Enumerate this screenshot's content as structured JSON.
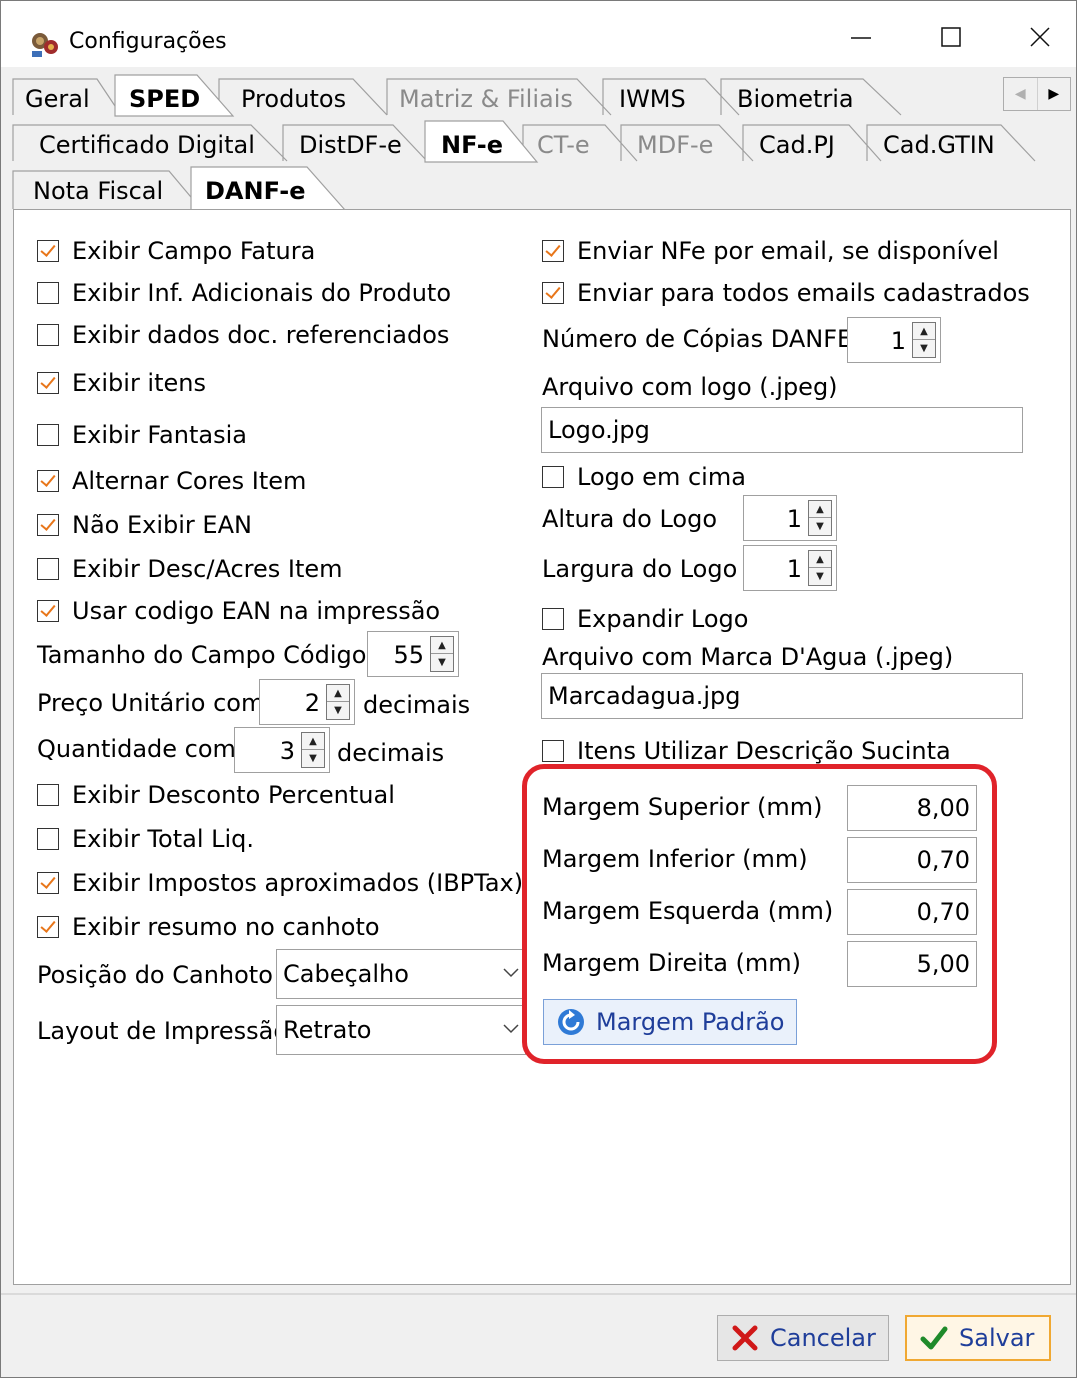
{
  "window": {
    "title": "Configurações",
    "minimize": "—",
    "maximize": "☐",
    "close": "✕"
  },
  "tabs_row1": [
    {
      "label": "Geral",
      "state": "normal"
    },
    {
      "label": "SPED",
      "state": "active"
    },
    {
      "label": "Produtos",
      "state": "normal"
    },
    {
      "label": "Matriz & Filiais",
      "state": "disabled"
    },
    {
      "label": "IWMS",
      "state": "normal"
    },
    {
      "label": "Biometria",
      "state": "normal"
    }
  ],
  "tabs_row2": [
    {
      "label": "Certificado Digital",
      "state": "normal"
    },
    {
      "label": "DistDF-e",
      "state": "normal"
    },
    {
      "label": "NF-e",
      "state": "active"
    },
    {
      "label": "CT-e",
      "state": "disabled"
    },
    {
      "label": "MDF-e",
      "state": "disabled"
    },
    {
      "label": "Cad.PJ",
      "state": "normal"
    },
    {
      "label": "Cad.GTIN",
      "state": "normal"
    }
  ],
  "tabs_row3": [
    {
      "label": "Nota Fiscal",
      "state": "normal"
    },
    {
      "label": "DANF-e",
      "state": "active"
    }
  ],
  "left": {
    "exibir_campo_fatura": {
      "label": "Exibir Campo Fatura",
      "checked": true
    },
    "exibir_inf_adicionais": {
      "label": "Exibir Inf. Adicionais do Produto",
      "checked": false
    },
    "exibir_dados_doc": {
      "label": "Exibir dados doc. referenciados",
      "checked": false
    },
    "exibir_itens": {
      "label": "Exibir itens",
      "checked": true
    },
    "exibir_fantasia": {
      "label": "Exibir Fantasia",
      "checked": false
    },
    "alternar_cores": {
      "label": "Alternar Cores Item",
      "checked": true
    },
    "nao_exibir_ean": {
      "label": "Não Exibir EAN",
      "checked": true
    },
    "exibir_desc_acres": {
      "label": "Exibir Desc/Acres Item",
      "checked": false
    },
    "usar_codigo_ean": {
      "label": "Usar codigo EAN na impressão",
      "checked": true
    },
    "tamanho_campo_codigo": {
      "label": "Tamanho do Campo Código",
      "value": "55"
    },
    "preco_unitario": {
      "label": "Preço Unitário com",
      "value": "2",
      "suffix": "decimais"
    },
    "quantidade": {
      "label": "Quantidade com",
      "value": "3",
      "suffix": "decimais"
    },
    "exibir_desconto_percentual": {
      "label": "Exibir Desconto Percentual",
      "checked": false
    },
    "exibir_total_liq": {
      "label": "Exibir Total Liq.",
      "checked": false
    },
    "exibir_impostos": {
      "label": "Exibir Impostos aproximados (IBPTax)",
      "checked": true
    },
    "exibir_resumo_canhoto": {
      "label": "Exibir resumo no canhoto",
      "checked": true
    },
    "posicao_canhoto": {
      "label": "Posição do Canhoto",
      "value": "Cabeçalho"
    },
    "layout_impressao": {
      "label": "Layout de Impressão",
      "value": "Retrato"
    }
  },
  "right": {
    "enviar_nfe_email": {
      "label": "Enviar NFe por email, se disponível",
      "checked": true
    },
    "enviar_todos_emails": {
      "label": "Enviar para todos emails cadastrados",
      "checked": true
    },
    "numero_copias": {
      "label": "Número de Cópias DANFE",
      "value": "1"
    },
    "arquivo_logo": {
      "label": "Arquivo com logo (.jpeg)",
      "value": "Logo.jpg"
    },
    "logo_em_cima": {
      "label": "Logo em cima",
      "checked": false
    },
    "altura_logo": {
      "label": "Altura do Logo",
      "value": "1"
    },
    "largura_logo": {
      "label": "Largura do Logo",
      "value": "1"
    },
    "expandir_logo": {
      "label": "Expandir Logo",
      "checked": false
    },
    "arquivo_marca_dagua": {
      "label": "Arquivo com Marca D'Agua (.jpeg)",
      "value": "Marcadagua.jpg"
    },
    "itens_descricao_sucinta": {
      "label": "Itens Utilizar Descrição Sucinta",
      "checked": false
    },
    "margem_superior": {
      "label": "Margem Superior (mm)",
      "value": "8,00"
    },
    "margem_inferior": {
      "label": "Margem Inferior (mm)",
      "value": "0,70"
    },
    "margem_esquerda": {
      "label": "Margem Esquerda (mm)",
      "value": "0,70"
    },
    "margem_direita": {
      "label": "Margem Direita (mm)",
      "value": "5,00"
    },
    "margem_padrao_button": {
      "label": "Margem Padrão",
      "icon": "refresh-icon"
    }
  },
  "footer": {
    "cancel": {
      "label": "Cancelar",
      "icon": "x-icon"
    },
    "save": {
      "label": "Salvar",
      "icon": "check-icon"
    }
  },
  "colors": {
    "highlight": "#e0232a",
    "check": "#e8761a",
    "button_text": "#1f3e9a"
  }
}
